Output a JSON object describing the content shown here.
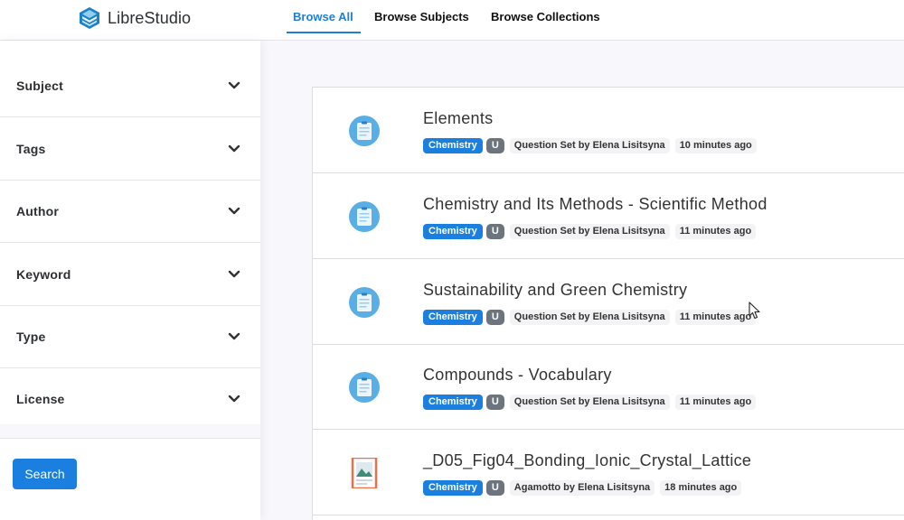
{
  "app": {
    "name": "LibreStudio"
  },
  "nav": {
    "tabs": [
      {
        "label": "Browse All",
        "active": true
      },
      {
        "label": "Browse Subjects",
        "active": false
      },
      {
        "label": "Browse Collections",
        "active": false
      }
    ]
  },
  "sidebar": {
    "filters": [
      {
        "label": "Subject",
        "icon": "chevron-down-icon"
      },
      {
        "label": "Tags",
        "icon": "chevron-down-icon"
      },
      {
        "label": "Author",
        "icon": "chevron-down-icon"
      },
      {
        "label": "Keyword",
        "icon": "chevron-down-icon"
      },
      {
        "label": "Type",
        "icon": "chevron-down-icon"
      },
      {
        "label": "License",
        "icon": "chevron-down-icon"
      }
    ],
    "search_label": "Search"
  },
  "results": [
    {
      "title": "Elements",
      "subject": "Chemistry",
      "badge": "U",
      "byline": "Question Set by Elena Lisitsyna",
      "time": "10 minutes ago",
      "icon": "question-set-icon"
    },
    {
      "title": "Chemistry and Its Methods - Scientific Method",
      "subject": "Chemistry",
      "badge": "U",
      "byline": "Question Set by Elena Lisitsyna",
      "time": "11 minutes ago",
      "icon": "question-set-icon"
    },
    {
      "title": "Sustainability and Green Chemistry",
      "subject": "Chemistry",
      "badge": "U",
      "byline": "Question Set by Elena Lisitsyna",
      "time": "11 minutes ago",
      "icon": "question-set-icon"
    },
    {
      "title": "Compounds - Vocabulary",
      "subject": "Chemistry",
      "badge": "U",
      "byline": "Question Set by Elena Lisitsyna",
      "time": "11 minutes ago",
      "icon": "question-set-icon"
    },
    {
      "title": "_D05_Fig04_Bonding_Ionic_Crystal_Lattice",
      "subject": "Chemistry",
      "badge": "U",
      "byline": "Agamotto by Elena Lisitsyna",
      "time": "18 minutes ago",
      "icon": "image-file-icon"
    }
  ],
  "colors": {
    "accent": "#1b7fe0",
    "nav_active": "#1f7fd4",
    "badge_gray": "#6c757d",
    "question_icon": "#5aaee6",
    "image_icon": "#e8714a"
  }
}
